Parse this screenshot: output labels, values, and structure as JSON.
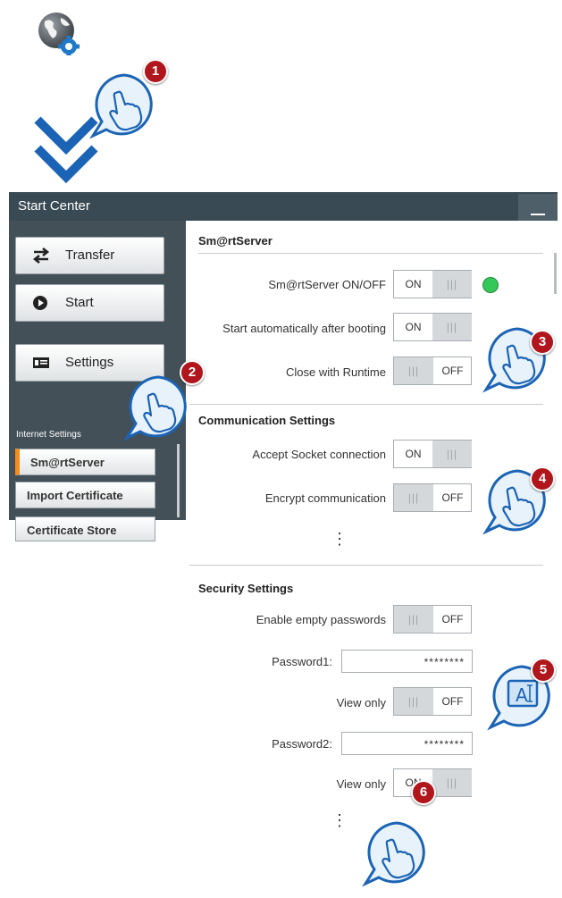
{
  "window": {
    "title": "Start Center"
  },
  "sidebar": {
    "buttons": [
      {
        "label": "Transfer",
        "icon": "transfer-arrows-icon"
      },
      {
        "label": "Start",
        "icon": "play-icon"
      },
      {
        "label": "Settings",
        "icon": "settings-panel-icon"
      }
    ],
    "section_label": "Internet Settings",
    "subitems": [
      {
        "label": "Sm@rtServer",
        "active": true
      },
      {
        "label": "Import Certificate",
        "active": false
      },
      {
        "label": "Certificate Store",
        "active": false
      }
    ]
  },
  "settings": {
    "smartserver": {
      "heading": "Sm@rtServer",
      "rows": [
        {
          "label": "Sm@rtServer ON/OFF",
          "state": "ON",
          "status_led": "green"
        },
        {
          "label": "Start automatically after booting",
          "state": "ON"
        },
        {
          "label": "Close with Runtime",
          "state": "OFF"
        }
      ]
    },
    "communication": {
      "heading": "Communication Settings",
      "rows": [
        {
          "label": "Accept Socket connection",
          "state": "ON"
        },
        {
          "label": "Encrypt communication",
          "state": "OFF"
        }
      ],
      "more": "⋮"
    },
    "security": {
      "heading": "Security Settings",
      "rows": [
        {
          "label": "Enable empty passwords",
          "state": "OFF"
        },
        {
          "label": "Password1:",
          "value": "********"
        },
        {
          "label": "View only",
          "state": "OFF"
        },
        {
          "label": "Password2:",
          "value": "********"
        },
        {
          "label": "View only",
          "state": "ON"
        }
      ],
      "more": "⋮"
    }
  },
  "toggle_text": {
    "on": "ON",
    "off": "OFF"
  },
  "callouts": [
    "1",
    "2",
    "3",
    "4",
    "5",
    "6"
  ],
  "colors": {
    "accent": "#f28c1c",
    "badge": "#b0161b",
    "led_on": "#34c759",
    "titlebar": "#3a4a55"
  }
}
